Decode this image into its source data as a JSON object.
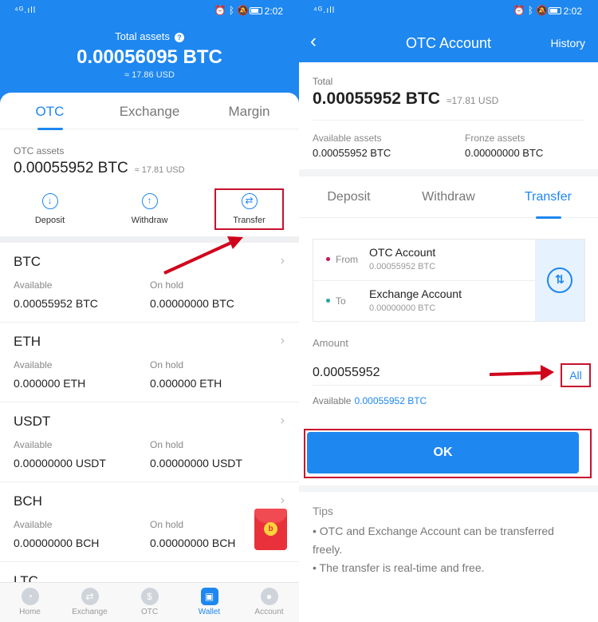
{
  "status_bar": {
    "signal": "⁴ᴳ.ıll",
    "time": "2:02"
  },
  "left": {
    "total_label": "Total assets",
    "total_value": "0.00056095 BTC",
    "total_usd": "≈ 17.86 USD",
    "tabs": [
      "OTC",
      "Exchange",
      "Margin"
    ],
    "otc_assets_label": "OTC assets",
    "otc_assets_value": "0.00055952 BTC",
    "otc_assets_usd": "≈ 17.81 USD",
    "actions": [
      {
        "label": "Deposit",
        "icon": "download-arrow-icon"
      },
      {
        "label": "Withdraw",
        "icon": "upload-arrow-icon"
      },
      {
        "label": "Transfer",
        "icon": "swap-arrows-icon"
      }
    ],
    "coins": [
      {
        "name": "BTC",
        "available_label": "Available",
        "available": "0.00055952 BTC",
        "onhold_label": "On hold",
        "onhold": "0.00000000 BTC"
      },
      {
        "name": "ETH",
        "available_label": "Available",
        "available": "0.000000 ETH",
        "onhold_label": "On hold",
        "onhold": "0.000000 ETH"
      },
      {
        "name": "USDT",
        "available_label": "Available",
        "available": "0.00000000 USDT",
        "onhold_label": "On hold",
        "onhold": "0.00000000 USDT"
      },
      {
        "name": "BCH",
        "available_label": "Available",
        "available": "0.00000000 BCH",
        "onhold_label": "On hold",
        "onhold": "0.00000000 BCH"
      },
      {
        "name": "LTC"
      }
    ],
    "bottom_nav": [
      "Home",
      "Exchange",
      "OTC",
      "Wallet",
      "Account"
    ],
    "accent": "#1e87f0",
    "highlight_color": "#c8102e"
  },
  "right": {
    "title": "OTC Account",
    "history": "History",
    "total_label": "Total",
    "total_value": "0.00055952 BTC",
    "total_usd": "≈17.81 USD",
    "available_label": "Available assets",
    "available_value": "0.00055952 BTC",
    "frozen_label": "Fronze assets",
    "frozen_value": "0.00000000 BTC",
    "tabs": [
      "Deposit",
      "Withdraw",
      "Transfer"
    ],
    "from_label": "From",
    "from_account": "OTC Account",
    "from_value": "0.00055952 BTC",
    "to_label": "To",
    "to_account": "Exchange Account",
    "to_value": "0.00000000 BTC",
    "amount_label": "Amount",
    "amount_value": "0.00055952",
    "all_label": "All",
    "available_prefix": "Available",
    "available_amount": "0.00055952 BTC",
    "ok_label": "OK",
    "tips_title": "Tips",
    "tips": [
      "• OTC and Exchange Account can be transferred",
      "freely.",
      "• The transfer is real-time and free."
    ]
  }
}
